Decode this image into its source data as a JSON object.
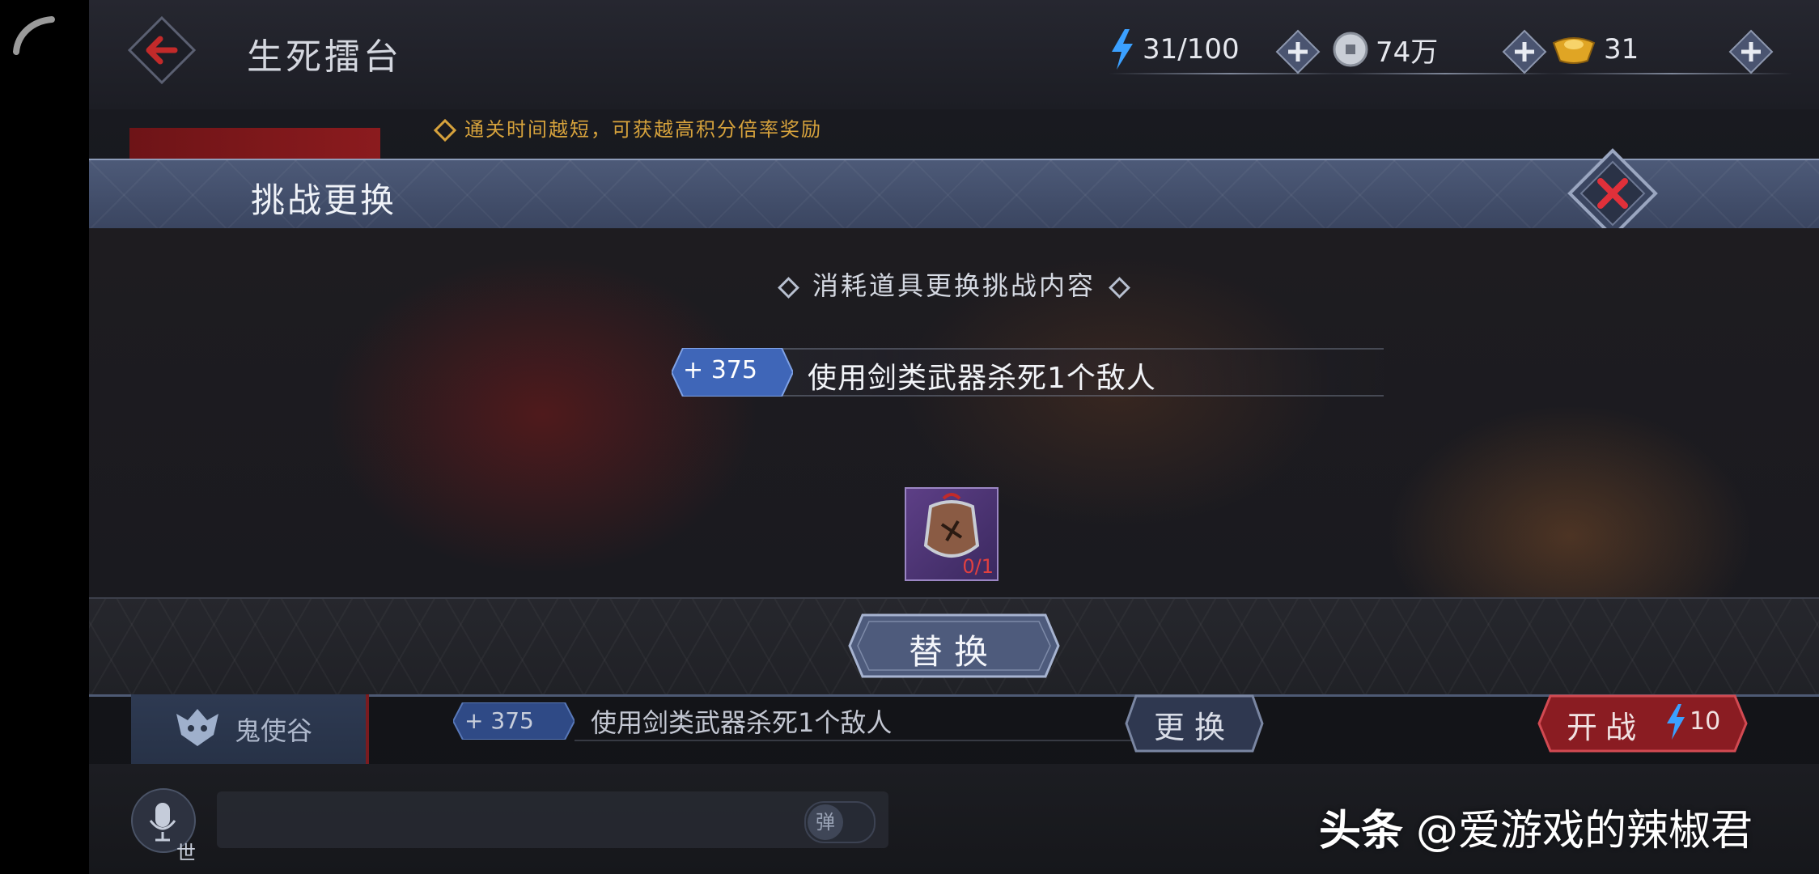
{
  "header": {
    "title": "生死擂台",
    "stamina": "31/100",
    "silver": "74万",
    "gold": "31"
  },
  "hint": "通关时间越短，可获越高积分倍率奖励",
  "modal": {
    "title": "挑战更换",
    "subtitle": "消耗道具更换挑战内容",
    "task": {
      "points": "375",
      "text": "使用剑类武器杀死1个敌人"
    },
    "item": {
      "count": "0/1"
    },
    "replace_label": "替换"
  },
  "row": {
    "faction": "鬼使谷",
    "points": "375",
    "task_text": "使用剑类武器杀死1个敌人",
    "swap_label": "更换",
    "fight_label": "开战",
    "fight_cost": "10"
  },
  "chat": {
    "channel": "世",
    "toggle_label": "弹"
  },
  "watermark": {
    "brand": "头条",
    "handle": "@爱游戏的辣椒君"
  },
  "colors": {
    "accent_blue": "#3f66b8",
    "accent_red": "#b0242a",
    "hint_gold": "#d6a23c"
  },
  "icons": [
    "back-arrow-icon",
    "lightning-icon",
    "silver-coin-icon",
    "gold-ingot-icon",
    "plus-icon",
    "close-icon",
    "demon-mask-icon",
    "microphone-icon"
  ]
}
